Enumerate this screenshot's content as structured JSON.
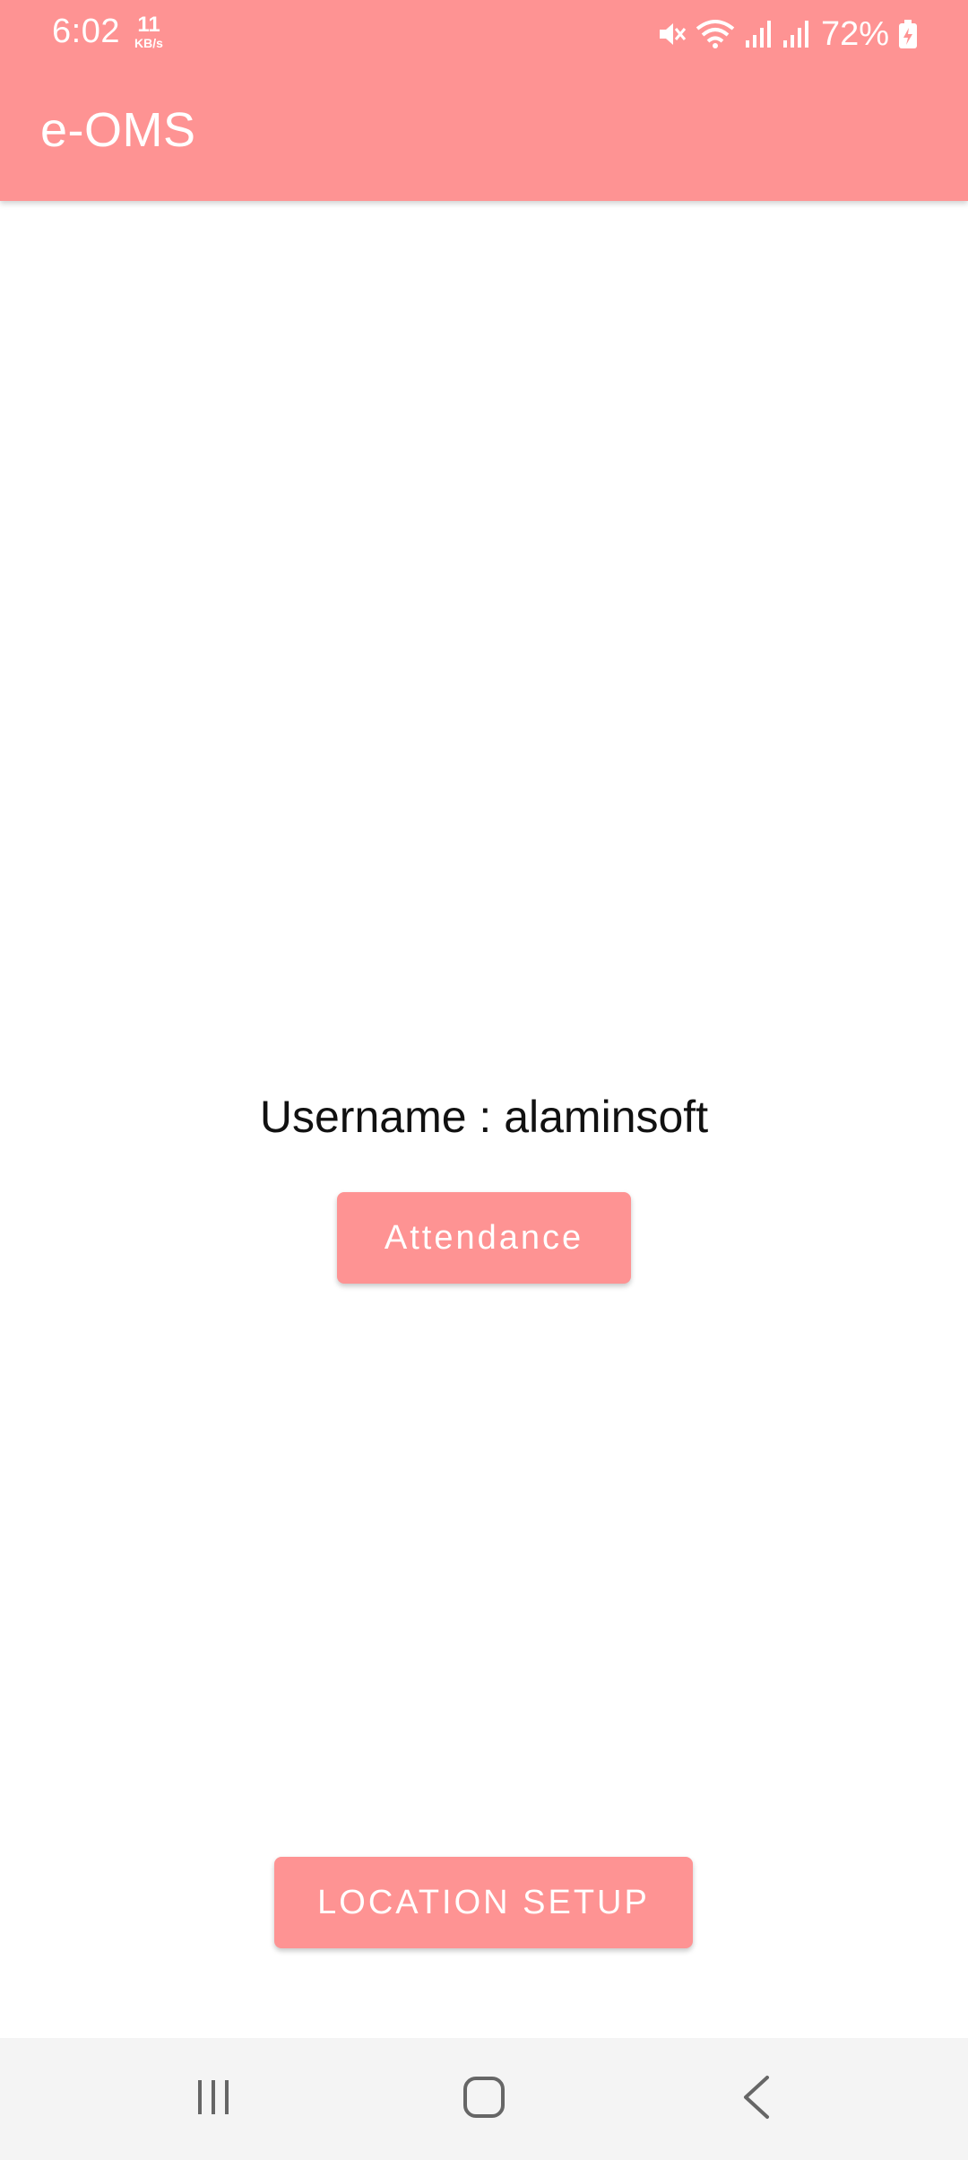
{
  "status_bar": {
    "time": "6:02",
    "net_speed_value": "11",
    "net_speed_unit": "KB/s",
    "battery_percent": "72%",
    "icons": [
      "mute-icon",
      "wifi-icon",
      "signal-icon",
      "signal-icon",
      "battery-icon"
    ]
  },
  "app_bar": {
    "title": "e-OMS"
  },
  "main": {
    "username_text": "Username : alaminsoft",
    "attendance_label": "Attendance",
    "location_setup_label": "LOCATION SETUP"
  },
  "nav_bar": {
    "icons": [
      "recents-icon",
      "home-icon",
      "back-icon"
    ]
  },
  "colors": {
    "accent": "#fe9393",
    "nav_background": "#f4f4f4",
    "text": "#111111"
  }
}
